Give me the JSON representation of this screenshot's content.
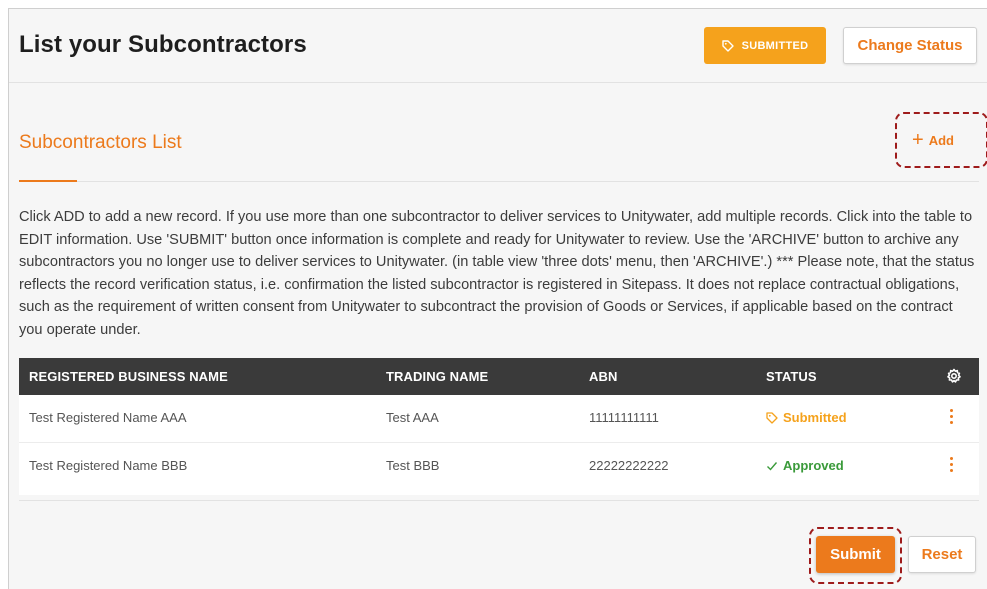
{
  "header": {
    "title": "List your Subcontractors",
    "status_label": "SUBMITTED",
    "change_status_label": "Change Status"
  },
  "section": {
    "title": "Subcontractors List",
    "add_label": "Add"
  },
  "instructions": "Click ADD to add a new record. If you use more than one subcontractor to deliver services to Unitywater, add multiple records. Click into the table to EDIT information. Use 'SUBMIT' button once information is complete and ready for Unitywater to review. Use the 'ARCHIVE' button to archive any subcontractors you no longer use to deliver services to Unitywater. (in table view 'three dots' menu, then 'ARCHIVE'.) *** Please note, that the status reflects the record verification status, i.e. confirmation the listed subcontractor is registered in Sitepass. It does not replace contractual obligations, such as the requirement of written consent from Unitywater to subcontract the provision of Goods or Services, if applicable based on the contract you operate under.",
  "table": {
    "columns": [
      "REGISTERED BUSINESS NAME",
      "TRADING NAME",
      "ABN",
      "STATUS"
    ],
    "rows": [
      {
        "business_name": "Test Registered Name AAA",
        "trading_name": "Test AAA",
        "abn": "11111111111",
        "status": "Submitted"
      },
      {
        "business_name": "Test Registered Name BBB",
        "trading_name": "Test BBB",
        "abn": "22222222222",
        "status": "Approved"
      }
    ]
  },
  "footer": {
    "submit_label": "Submit",
    "reset_label": "Reset"
  },
  "colors": {
    "accent": "#ec7a1c",
    "submitted": "#f5a21c",
    "approved": "#3a9a3a",
    "header_bg": "#3a3a3a",
    "highlight": "#9e1b1b"
  },
  "icons": [
    "tag-icon",
    "plus-icon",
    "gear-icon",
    "check-icon",
    "more-vertical-icon"
  ]
}
